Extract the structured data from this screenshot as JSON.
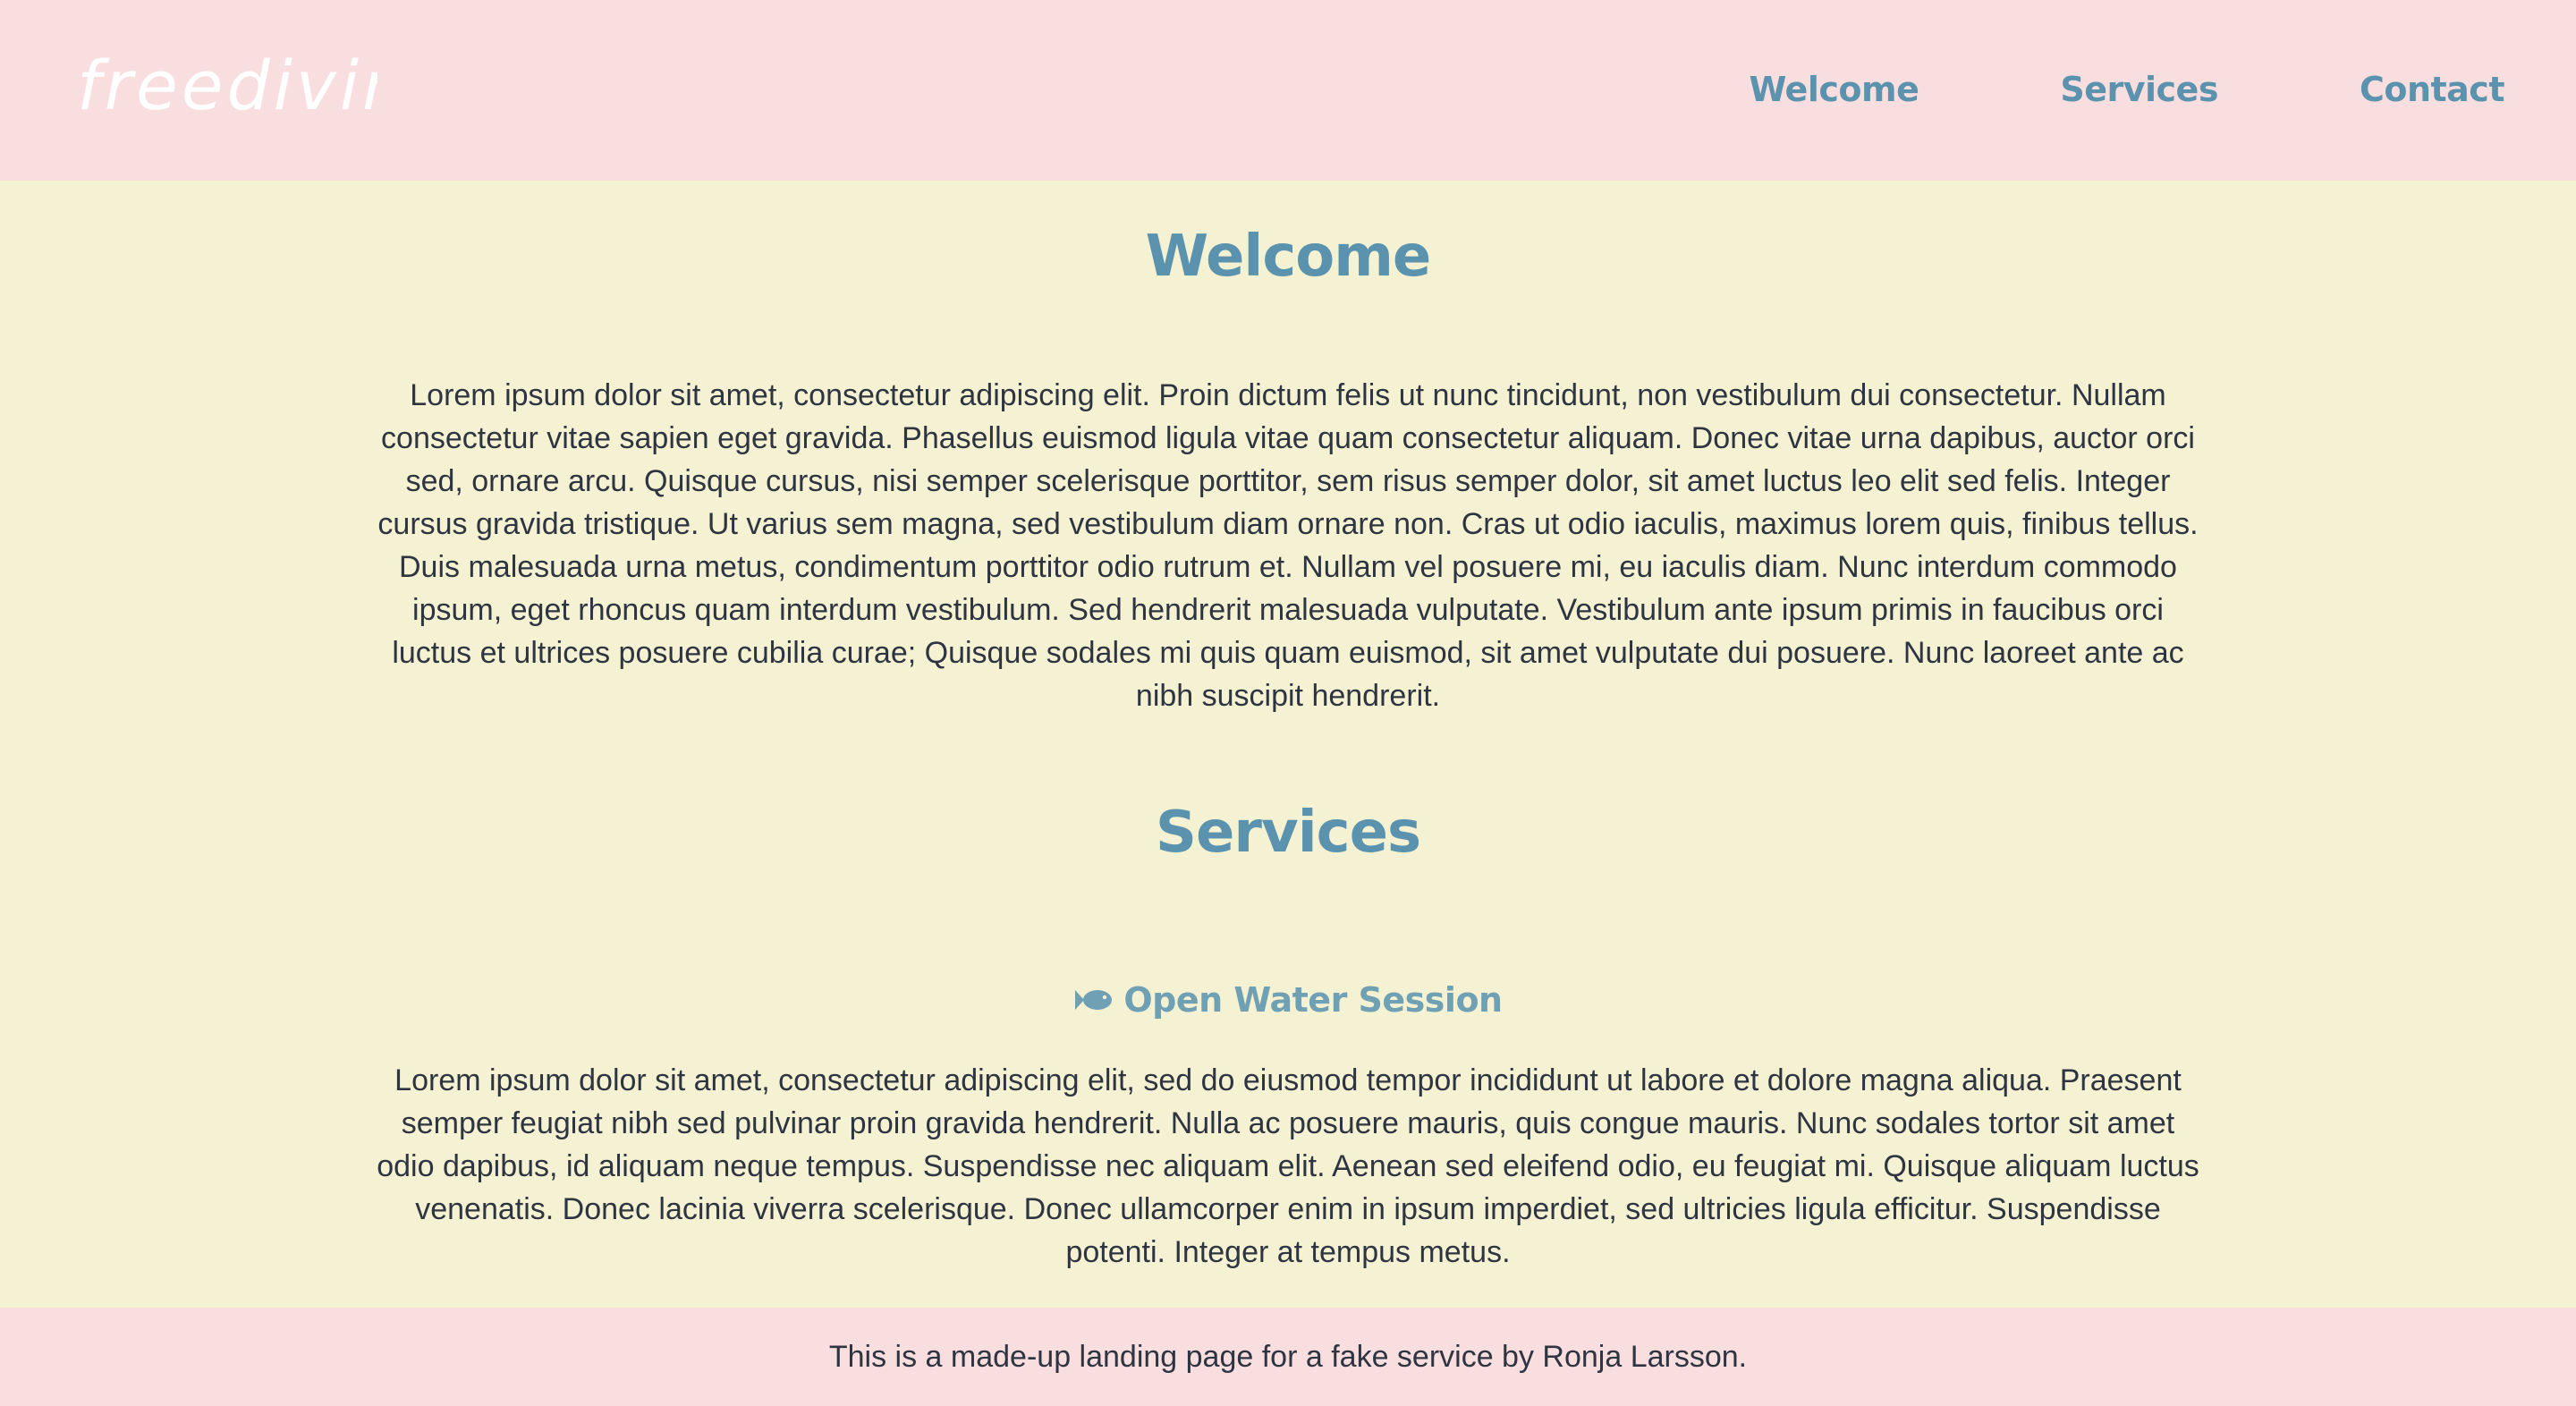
{
  "header": {
    "logo_text": "freediving",
    "nav": {
      "welcome": "Welcome",
      "services": "Services",
      "contact": "Contact"
    }
  },
  "welcome": {
    "title": "Welcome",
    "text": "Lorem ipsum dolor sit amet, consectetur adipiscing elit. Proin dictum felis ut nunc tincidunt, non vestibulum dui consectetur. Nullam consectetur vitae sapien eget gravida. Phasellus euismod ligula vitae quam consectetur aliquam. Donec vitae urna dapibus, auctor orci sed, ornare arcu. Quisque cursus, nisi semper scelerisque porttitor, sem risus semper dolor, sit amet luctus leo elit sed felis. Integer cursus gravida tristique. Ut varius sem magna, sed vestibulum diam ornare non. Cras ut odio iaculis, maximus lorem quis, finibus tellus. Duis malesuada urna metus, condimentum porttitor odio rutrum et. Nullam vel posuere mi, eu iaculis diam. Nunc interdum commodo ipsum, eget rhoncus quam interdum vestibulum. Sed hendrerit malesuada vulputate. Vestibulum ante ipsum primis in faucibus orci luctus et ultrices posuere cubilia curae; Quisque sodales mi quis quam euismod, sit amet vulputate dui posuere. Nunc laoreet ante ac nibh suscipit hendrerit."
  },
  "services": {
    "title": "Services",
    "items": [
      {
        "icon": "fish-icon",
        "title": "Open Water Session",
        "text": "Lorem ipsum dolor sit amet, consectetur adipiscing elit, sed do eiusmod tempor incididunt ut labore et dolore magna aliqua. Praesent semper feugiat nibh sed pulvinar proin gravida hendrerit. Nulla ac posuere mauris, quis congue mauris. Nunc sodales tortor sit amet odio dapibus, id aliquam neque tempus. Suspendisse nec aliquam elit. Aenean sed eleifend odio, eu feugiat mi. Quisque aliquam luctus venenatis. Donec lacinia viverra scelerisque. Donec ullamcorper enim in ipsum imperdiet, sed ultricies ligula efficitur. Suspendisse potenti. Integer at tempus metus."
      }
    ]
  },
  "footer": {
    "text": "This is a made-up landing page for a fake service by Ronja Larsson."
  },
  "colors": {
    "header_bg": "#F9DEDF",
    "page_bg": "#F5F2D3",
    "accent": "#5B93AE",
    "text": "#2F3441",
    "logo": "#FFFFFF"
  }
}
